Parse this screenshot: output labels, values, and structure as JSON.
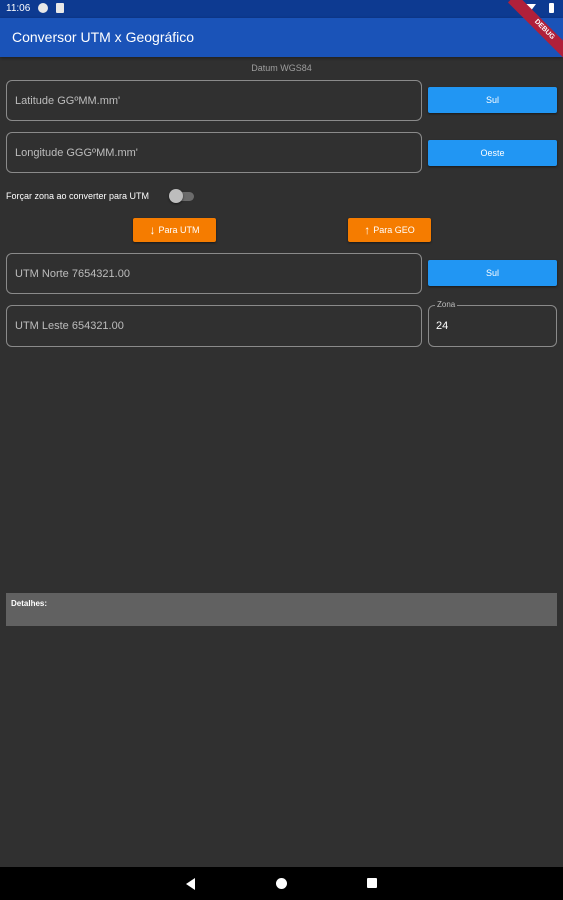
{
  "status_bar": {
    "time": "11:06",
    "icons": [
      "notification-icon",
      "sim-icon",
      "wifi-icon",
      "battery-icon"
    ]
  },
  "app_bar": {
    "title": "Conversor UTM x Geográfico",
    "debug_banner": "DEBUG"
  },
  "datum": "Datum WGS84",
  "latitude": {
    "placeholder": "Latitude GGºMM.mm'",
    "hemisphere_button": "Sul"
  },
  "longitude": {
    "placeholder": "Longitude GGGºMM.mm'",
    "hemisphere_button": "Oeste"
  },
  "force_zone": {
    "label": "Forçar zona ao converter para UTM",
    "enabled": false
  },
  "convert": {
    "to_utm_label": "Para UTM",
    "to_geo_label": "Para GEO",
    "to_utm_icon": "arrow-down-icon",
    "to_geo_icon": "arrow-up-icon",
    "color": "#f57c00"
  },
  "utm_north": {
    "placeholder": "UTM Norte 7654321.00",
    "hemisphere_button": "Sul"
  },
  "utm_east": {
    "placeholder": "UTM Leste 654321.00"
  },
  "zone": {
    "label": "Zona",
    "value": "24"
  },
  "details": {
    "label": "Detalhes:"
  },
  "colors": {
    "background": "#303030",
    "app_bar": "#1a53b8",
    "button_blue": "#2196f3"
  },
  "nav_bar": {
    "icons": [
      "back-icon",
      "home-icon",
      "recents-icon"
    ]
  }
}
